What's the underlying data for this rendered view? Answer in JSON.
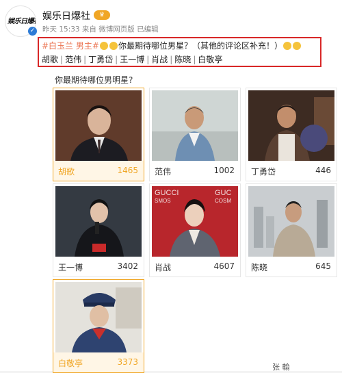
{
  "account": {
    "logo_text": "娱乐日爆社",
    "name": "娱乐日爆社",
    "meta": "昨天 15:33  来自 微博网页版  已编辑"
  },
  "post": {
    "hashtag": "#白玉兰 男主#",
    "question": "你最期待哪位男星？（其他的评论区补充！）",
    "candidates": [
      "胡歌",
      "范伟",
      "丁勇岱",
      "王一博",
      "肖战",
      "陈晓",
      "白敬亭"
    ]
  },
  "poll": {
    "question": "你最期待哪位男明星?",
    "options": [
      {
        "name": "胡歌",
        "votes": "1465"
      },
      {
        "name": "范伟",
        "votes": "1002"
      },
      {
        "name": "丁勇岱",
        "votes": "446"
      },
      {
        "name": "王一博",
        "votes": "3402"
      },
      {
        "name": "肖战",
        "votes": "4607"
      },
      {
        "name": "陈晓",
        "votes": "645"
      },
      {
        "name": "白敬亭",
        "votes": "3373"
      }
    ],
    "photo_text": {
      "gucci_left": "GUCCI",
      "smos": "SMOS",
      "gucci_right": "GUC",
      "cosm": "COSM"
    }
  },
  "bottom_text": "张 翰"
}
